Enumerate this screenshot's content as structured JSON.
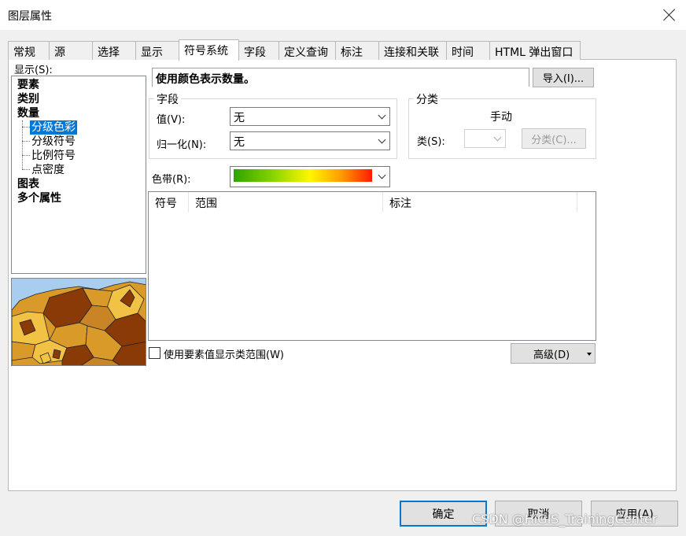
{
  "window": {
    "title": "图层属性"
  },
  "tabs": [
    {
      "label": "常规"
    },
    {
      "label": "源"
    },
    {
      "label": "选择"
    },
    {
      "label": "显示"
    },
    {
      "label": "符号系统"
    },
    {
      "label": "字段"
    },
    {
      "label": "定义查询"
    },
    {
      "label": "标注"
    },
    {
      "label": "连接和关联"
    },
    {
      "label": "时间"
    },
    {
      "label": "HTML 弹出窗口"
    }
  ],
  "active_tab": "符号系统",
  "show_panel": {
    "label": "显示(S):",
    "tree": [
      {
        "label": "要素"
      },
      {
        "label": "类别"
      },
      {
        "label": "数量"
      },
      {
        "label": "分级色彩"
      },
      {
        "label": "分级符号"
      },
      {
        "label": "比例符号"
      },
      {
        "label": "点密度"
      },
      {
        "label": "图表"
      },
      {
        "label": "多个属性"
      }
    ],
    "selected": "分级色彩"
  },
  "description": "使用颜色表示数量。",
  "import_button": "导入(I)...",
  "fields_group": {
    "title": "字段",
    "value_label": "值(V):",
    "value": "无",
    "normalize_label": "归一化(N):",
    "normalize": "无"
  },
  "classification_group": {
    "title": "分类",
    "method": "手动",
    "classes_label": "类(S):",
    "classes_value": "",
    "classify_button": "分类(C)..."
  },
  "color_ramp": {
    "label": "色带(R):"
  },
  "colors": {
    "ramp": [
      "#2ea300",
      "#86d400",
      "#fff700",
      "#ff9a00",
      "#ff1a00"
    ],
    "selection": "#0078d7"
  },
  "table": {
    "columns": [
      {
        "label": "符号"
      },
      {
        "label": "范围"
      },
      {
        "label": "标注"
      }
    ],
    "rows": []
  },
  "use_feature_values_label": "使用要素值显示类范围(W)",
  "advanced_button": "高级(D)",
  "footer": {
    "ok": "确定",
    "cancel": "取消",
    "apply": "应用(A)"
  },
  "watermark": "CSDN @HiGIS_TrainingCenter"
}
